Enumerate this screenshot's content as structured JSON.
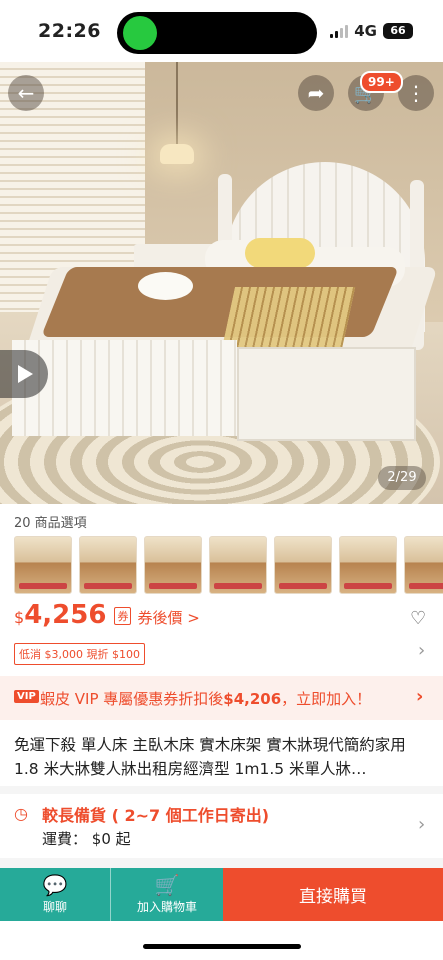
{
  "status": {
    "time": "22:26",
    "network": "4G",
    "battery": "66"
  },
  "header": {
    "back_icon": "arrow-left-icon",
    "share_icon": "share-icon",
    "cart_icon": "cart-icon",
    "cart_badge": "99+",
    "more_icon": "more-vertical-icon"
  },
  "gallery": {
    "counter": "2/29",
    "play_icon": "play-icon"
  },
  "variants": {
    "label": "20 商品選項",
    "count_shown": 7
  },
  "price": {
    "symbol": "$",
    "amount": "4,256",
    "after_coupon": "券後價 >",
    "coupon_icon": "券"
  },
  "promo": {
    "tag": "低消 $3,000 現折 $100",
    "chevron": "›"
  },
  "vip": {
    "badge": "VIP",
    "text_prefix": "蝦皮 VIP 專屬優惠券折扣後",
    "amount": "$4,206",
    "text_suffix": "，立即加入！",
    "chevron": "›"
  },
  "product": {
    "title": "免運下殺 單人床 主臥木床 實木床架 實木牀現代簡約家用 1.8 米大牀雙人牀出租房經濟型 1m1.5 米單人牀…"
  },
  "shipping": {
    "title": "較長備貨 ( 2~7 個工作日寄出)",
    "fee_label": "運費：",
    "fee_value": "$0 起",
    "chevron": "›"
  },
  "bottom": {
    "chat_label": "聊聊",
    "add_cart_label": "加入購物車",
    "buy_label": "直接購買"
  },
  "colors": {
    "accent": "#ee4d2d",
    "teal": "#26aa99"
  }
}
